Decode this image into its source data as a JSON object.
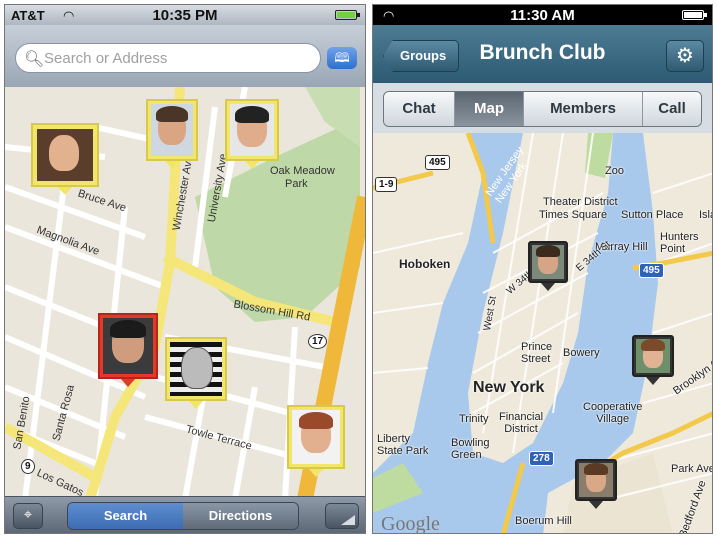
{
  "left_phone": {
    "status": {
      "carrier": "AT&T",
      "time": "10:35 PM"
    },
    "search": {
      "placeholder": "Search or Address"
    },
    "toolbar": {
      "search_label": "Search",
      "directions_label": "Directions"
    },
    "map_labels": {
      "oak_meadow": "Oak Meadow",
      "park": "Park",
      "bruce_ave": "Bruce Ave",
      "winchester": "Winchester Ave",
      "university": "University Ave",
      "blossom": "Blossom Hill Rd",
      "magnolia": "Magnolia Ave",
      "towle": "Towle Terrace",
      "san_benito": "San Benito",
      "santa_rosa": "Santa Rosa",
      "route_17": "17",
      "route_9": "9",
      "los_gatos": "Los Gatos"
    },
    "colors": {
      "pin_default": "#f2e66a",
      "pin_selected": "#e23a2a"
    }
  },
  "right_phone": {
    "status": {
      "time": "11:30 AM"
    },
    "nav": {
      "back_label": "Groups",
      "title": "Brunch Club"
    },
    "tabs": [
      "Chat",
      "Map",
      "Members",
      "Call"
    ],
    "selected_tab": "Map",
    "map_labels": {
      "hoboken": "Hoboken",
      "new_york": "New York",
      "theater_district": "Theater District",
      "times_square": "Times Square",
      "sutton_place": "Sutton Place",
      "murray_hill": "Murray Hill",
      "hunters_point": "Hunters\nPoint",
      "prince_street": "Prince\nStreet",
      "bowery": "Bowery",
      "cooperative_village": "Cooperative\nVillage",
      "trinity": "Trinity",
      "financial_district": "Financial\nDistrict",
      "bowling_green": "Bowling\nGreen",
      "liberty_state_park": "Liberty\nState Park",
      "boerum_hill": "Boerum Hill",
      "park_ave": "Park Ave",
      "bedford_ave": "Bedford Ave",
      "w_34th": "W 34th St",
      "e_34th": "E 34th St",
      "west_st": "West St",
      "zoo": "Zoo",
      "new_jersey": "New Jersey\nNew York",
      "route_495": "495",
      "route_278": "278",
      "route_1_9": "1-9",
      "route_495b": "495",
      "google": "Google",
      "brooklyn": "Brooklyn Qu",
      "island": "Islan"
    }
  }
}
